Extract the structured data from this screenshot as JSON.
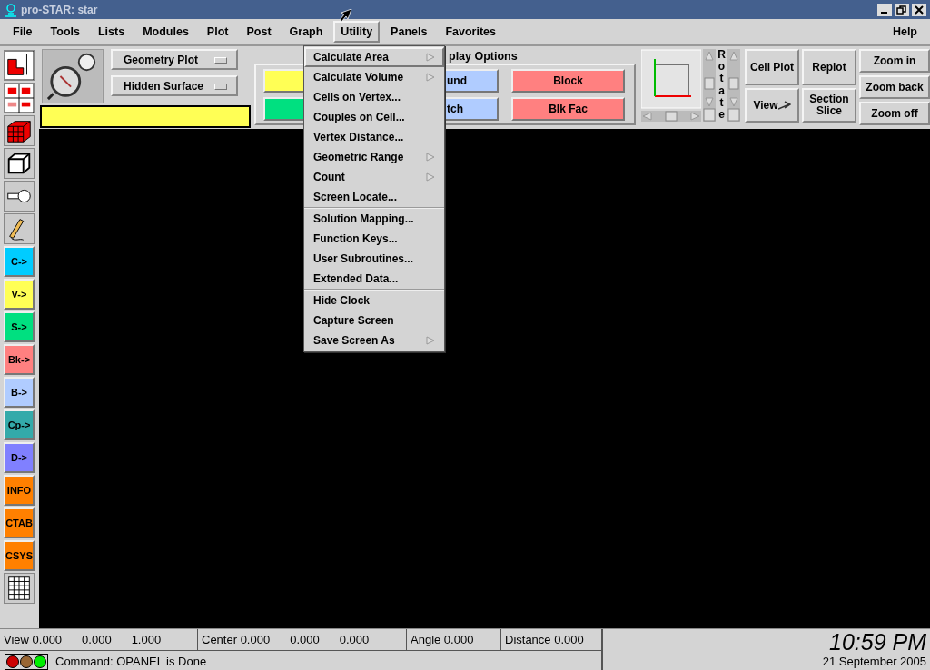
{
  "window": {
    "title": "pro-STAR: star"
  },
  "menubar": {
    "items": [
      {
        "label": "File",
        "selected": false
      },
      {
        "label": "Tools",
        "selected": false
      },
      {
        "label": "Lists",
        "selected": false
      },
      {
        "label": "Modules",
        "selected": false
      },
      {
        "label": "Plot",
        "selected": false
      },
      {
        "label": "Post",
        "selected": false
      },
      {
        "label": "Graph",
        "selected": false
      },
      {
        "label": "Utility",
        "selected": true
      },
      {
        "label": "Panels",
        "selected": false
      },
      {
        "label": "Favorites",
        "selected": false
      }
    ],
    "help": "Help"
  },
  "utility_menu": {
    "groups": [
      [
        {
          "label": "Calculate Area",
          "submenu": true,
          "selected": true
        },
        {
          "label": "Calculate Volume",
          "submenu": true,
          "selected": false
        },
        {
          "label": "Cells on Vertex...",
          "submenu": false,
          "selected": false
        },
        {
          "label": "Couples on Cell...",
          "submenu": false,
          "selected": false
        },
        {
          "label": "Vertex Distance...",
          "submenu": false,
          "selected": false
        },
        {
          "label": "Geometric Range",
          "submenu": true,
          "selected": false
        },
        {
          "label": "Count",
          "submenu": true,
          "selected": false
        },
        {
          "label": "Screen Locate...",
          "submenu": false,
          "selected": false
        }
      ],
      [
        {
          "label": "Solution Mapping...",
          "submenu": false,
          "selected": false
        },
        {
          "label": "Function Keys...",
          "submenu": false,
          "selected": false
        },
        {
          "label": "User Subroutines...",
          "submenu": false,
          "selected": false
        },
        {
          "label": "Extended Data...",
          "submenu": false,
          "selected": false
        }
      ],
      [
        {
          "label": "Hide Clock",
          "submenu": false,
          "selected": false
        },
        {
          "label": "Capture Screen",
          "submenu": false,
          "selected": false
        },
        {
          "label": "Save Screen As",
          "submenu": true,
          "selected": false
        }
      ]
    ]
  },
  "left_tools": [
    {
      "kind": "icon"
    },
    {
      "kind": "icon"
    },
    {
      "kind": "icon"
    },
    {
      "kind": "icon"
    },
    {
      "kind": "icon"
    },
    {
      "kind": "icon"
    },
    {
      "kind": "text",
      "label": "C->",
      "color": "#00ccff"
    },
    {
      "kind": "text",
      "label": "V->",
      "color": "#ffff55"
    },
    {
      "kind": "text",
      "label": "S->",
      "color": "#00e080"
    },
    {
      "kind": "text",
      "label": "Bk->",
      "color": "#ff8080"
    },
    {
      "kind": "text",
      "label": "B->",
      "color": "#b0ccff"
    },
    {
      "kind": "text",
      "label": "Cp->",
      "color": "#33aaaa"
    },
    {
      "kind": "text",
      "label": "D->",
      "color": "#8080ff"
    },
    {
      "kind": "text",
      "label": "INFO",
      "color": "#ff8000"
    },
    {
      "kind": "text",
      "label": "CTAB",
      "color": "#ff8000"
    },
    {
      "kind": "text",
      "label": "CSYS",
      "color": "#ff8000"
    },
    {
      "kind": "icon"
    }
  ],
  "plot_options": [
    {
      "label": "Geometry Plot"
    },
    {
      "label": "Hidden Surface"
    }
  ],
  "display_options": {
    "title": "play Options",
    "buttons": [
      {
        "color": "#ffff55"
      },
      {
        "label": "und",
        "color": "#b0ccff"
      },
      {
        "label": "Block",
        "color": "#ff8080"
      },
      {
        "color": "#00e080"
      },
      {
        "label": "tch",
        "color": "#b0ccff"
      },
      {
        "label": "Blk Fac",
        "color": "#ff8080"
      }
    ]
  },
  "rotate_label": "Rotate",
  "view_buttons": [
    {
      "label": "Cell Plot"
    },
    {
      "label": "Replot"
    },
    {
      "label": "View"
    },
    {
      "label": "Section Slice"
    }
  ],
  "zoom_buttons": [
    "Zoom in",
    "Zoom back",
    "Zoom off"
  ],
  "status": {
    "view": [
      "View 0.000",
      "0.000",
      "1.000"
    ],
    "center": [
      "Center 0.000",
      "0.000",
      "0.000"
    ],
    "angle": "Angle 0.000",
    "distance": "Distance 0.000",
    "lights": [
      {
        "color": "#cc0000"
      },
      {
        "color": "#996633"
      },
      {
        "color": "#00ee00"
      }
    ],
    "command": "Command: OPANEL is Done",
    "time": "10:59 PM",
    "date": "21 September 2005"
  }
}
